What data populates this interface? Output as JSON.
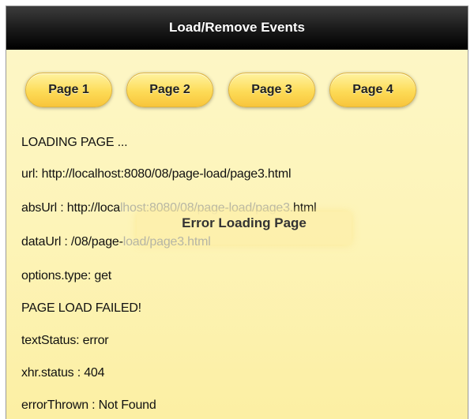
{
  "header": {
    "title": "Load/Remove Events"
  },
  "nav": {
    "buttons": [
      {
        "label": "Page 1"
      },
      {
        "label": "Page 2"
      },
      {
        "label": "Page 3"
      },
      {
        "label": "Page 4"
      }
    ]
  },
  "log": {
    "loading": "LOADING PAGE ...",
    "url": "url: http://localhost:8080/08/page-load/page3.html",
    "absurl_prefix": "absUrl : http://loca",
    "absurl_hidden": "lhost:8080/08/page-load/page3.",
    "absurl_suffix": "html",
    "dataurl_prefix": "dataUrl : /08/page-",
    "dataurl_hidden": "load/page3.html",
    "options_type": "options.type: get",
    "failed": "PAGE LOAD FAILED!",
    "text_status": "textStatus: error",
    "xhr_status": "xhr.status : 404",
    "error_thrown": "errorThrown : Not Found"
  },
  "toast": {
    "message": "Error Loading Page"
  }
}
